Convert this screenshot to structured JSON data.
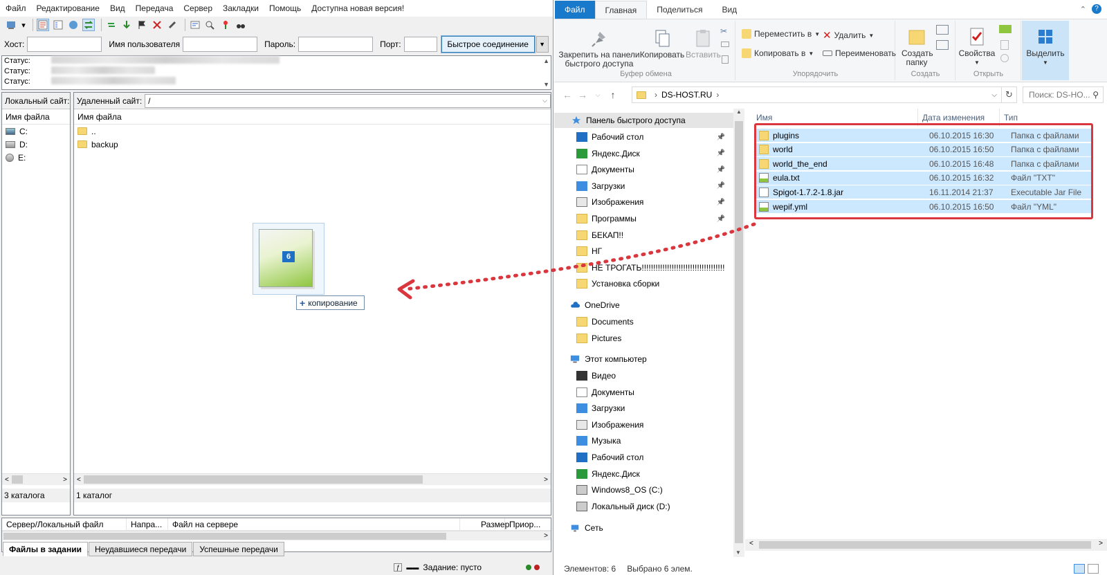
{
  "filezilla": {
    "menu": [
      "Файл",
      "Редактирование",
      "Вид",
      "Передача",
      "Сервер",
      "Закладки",
      "Помощь",
      "Доступна новая версия!"
    ],
    "quickconnect": {
      "host_label": "Хост:",
      "user_label": "Имя пользователя",
      "pass_label": "Пароль:",
      "port_label": "Порт:",
      "button": "Быстрое соединение",
      "dropdown_arrow": "▼"
    },
    "log": {
      "lines": [
        "Статус:",
        "Статус:",
        "Статус:"
      ]
    },
    "local": {
      "site_label": "Локальный сайт:",
      "col_name": "Имя файла",
      "drives": [
        "C:",
        "D:",
        "E:"
      ],
      "status": "3 каталога"
    },
    "remote": {
      "site_label": "Удаленный сайт:",
      "path": "/",
      "col_name": "Имя файла",
      "entries": [
        "..",
        "backup"
      ],
      "status": "1 каталог"
    },
    "queue": {
      "headers": [
        "Сервер/Локальный файл",
        "Напра...",
        "Файл на сервере",
        "Размер",
        "Приор..."
      ]
    },
    "tabs": [
      "Файлы в задании",
      "Неудавшиеся передачи",
      "Успешные передачи"
    ],
    "statusbar": {
      "task": "Задание: пусто"
    },
    "drag": {
      "badge_number": "6",
      "copy_label": "копирование",
      "copy_plus": "+"
    }
  },
  "explorer": {
    "tabs": [
      "Файл",
      "Главная",
      "Поделиться",
      "Вид"
    ],
    "ribbon": {
      "pin": "Закрепить на панели быстрого доступа",
      "copy": "Копировать",
      "paste": "Вставить",
      "clipboard_group": "Буфер обмена",
      "move_to": "Переместить в",
      "copy_to": "Копировать в",
      "delete": "Удалить",
      "rename": "Переименовать",
      "organize_group": "Упорядочить",
      "new_folder": "Создать папку",
      "create_group": "Создать",
      "properties": "Свойства",
      "open_group": "Открыть",
      "select": "Выделить"
    },
    "address": {
      "path": "DS-HOST.RU",
      "search_placeholder": "Поиск: DS-HO..."
    },
    "nav": {
      "quick_access": "Панель быстрого доступа",
      "quick_items": [
        "Рабочий стол",
        "Яндекс.Диск",
        "Документы",
        "Загрузки",
        "Изображения",
        "Программы",
        "БЕКАП!!",
        "НГ",
        "НЕ ТРОГАТЬ!!!!!!!!!!!!!!!!!!!!!!!!!!!!!!!!!!!!",
        "Установка сборки"
      ],
      "onedrive": "OneDrive",
      "onedrive_items": [
        "Documents",
        "Pictures"
      ],
      "this_pc": "Этот компьютер",
      "pc_items": [
        "Видео",
        "Документы",
        "Загрузки",
        "Изображения",
        "Музыка",
        "Рабочий стол",
        "Яндекс.Диск",
        "Windows8_OS (C:)",
        "Локальный диск (D:)"
      ],
      "network": "Сеть"
    },
    "columns": {
      "name": "Имя",
      "date": "Дата изменения",
      "type": "Тип"
    },
    "files": [
      {
        "name": "plugins",
        "date": "06.10.2015 16:30",
        "type": "Папка с файлами",
        "kind": "folder"
      },
      {
        "name": "world",
        "date": "06.10.2015 16:50",
        "type": "Папка с файлами",
        "kind": "folder"
      },
      {
        "name": "world_the_end",
        "date": "06.10.2015 16:48",
        "type": "Папка с файлами",
        "kind": "folder"
      },
      {
        "name": "eula.txt",
        "date": "06.10.2015 16:32",
        "type": "Файл \"TXT\"",
        "kind": "txt"
      },
      {
        "name": "Spigot-1.7.2-1.8.jar",
        "date": "16.11.2014 21:37",
        "type": "Executable Jar File",
        "kind": "jar"
      },
      {
        "name": "wepif.yml",
        "date": "06.10.2015 16:50",
        "type": "Файл \"YML\"",
        "kind": "yml"
      }
    ],
    "status": {
      "count": "Элементов: 6",
      "selected": "Выбрано 6 элем."
    }
  },
  "colors": {
    "accent": "#1979ca",
    "selection": "#cce8ff",
    "highlight_red": "#d9363e"
  }
}
